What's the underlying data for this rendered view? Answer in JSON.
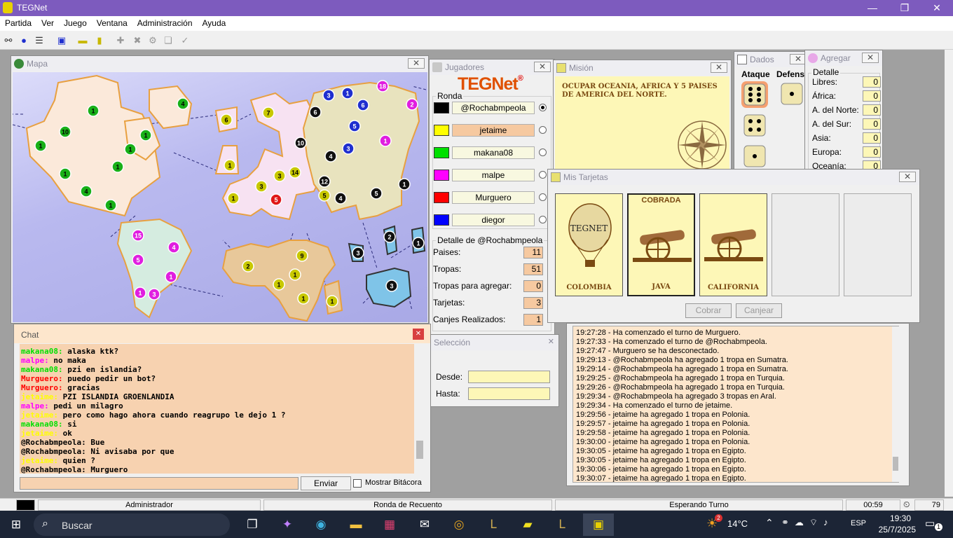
{
  "window": {
    "title": "TEGNet"
  },
  "menu": [
    "Partida",
    "Ver",
    "Juego",
    "Ventana",
    "Administración",
    "Ayuda"
  ],
  "map": {
    "title": "Mapa",
    "territories": [
      {
        "n": "1",
        "c": "#18b018"
      },
      {
        "n": "10",
        "c": "#18b018"
      },
      {
        "n": "1",
        "c": "#18b018"
      },
      {
        "n": "1",
        "c": "#18b018"
      },
      {
        "n": "1",
        "c": "#18b018"
      },
      {
        "n": "1",
        "c": "#18b018"
      },
      {
        "n": "1",
        "c": "#18b018"
      },
      {
        "n": "4",
        "c": "#18b018"
      },
      {
        "n": "1",
        "c": "#18b018"
      },
      {
        "n": "4",
        "c": "#18b018"
      },
      {
        "n": "6",
        "c": "#c8c800"
      },
      {
        "n": "1",
        "c": "#c8c800"
      },
      {
        "n": "7",
        "c": "#c8c800"
      },
      {
        "n": "3",
        "c": "#c8c800"
      },
      {
        "n": "3",
        "c": "#c8c800"
      },
      {
        "n": "1",
        "c": "#c8c800"
      },
      {
        "n": "14",
        "c": "#c8c800"
      },
      {
        "n": "5",
        "c": "#c8c800"
      },
      {
        "n": "9",
        "c": "#c8c800"
      },
      {
        "n": "2",
        "c": "#c8c800"
      },
      {
        "n": "1",
        "c": "#c8c800"
      },
      {
        "n": "1",
        "c": "#c8c800"
      },
      {
        "n": "1",
        "c": "#c8c800"
      },
      {
        "n": "1",
        "c": "#c8c800"
      },
      {
        "n": "10",
        "c": "#111111"
      },
      {
        "n": "6",
        "c": "#111111"
      },
      {
        "n": "4",
        "c": "#111111"
      },
      {
        "n": "12",
        "c": "#111111"
      },
      {
        "n": "4",
        "c": "#111111"
      },
      {
        "n": "5",
        "c": "#111111"
      },
      {
        "n": "1",
        "c": "#111111"
      },
      {
        "n": "2",
        "c": "#111111"
      },
      {
        "n": "1",
        "c": "#111111"
      },
      {
        "n": "3",
        "c": "#111111"
      },
      {
        "n": "3",
        "c": "#111111"
      },
      {
        "n": "3",
        "c": "#1f2fcf"
      },
      {
        "n": "1",
        "c": "#1f2fcf"
      },
      {
        "n": "6",
        "c": "#1f2fcf"
      },
      {
        "n": "5",
        "c": "#1f2fcf"
      },
      {
        "n": "3",
        "c": "#1f2fcf"
      },
      {
        "n": "18",
        "c": "#e01ee0"
      },
      {
        "n": "2",
        "c": "#e01ee0"
      },
      {
        "n": "1",
        "c": "#e01ee0"
      },
      {
        "n": "15",
        "c": "#e01ee0"
      },
      {
        "n": "4",
        "c": "#e01ee0"
      },
      {
        "n": "5",
        "c": "#e01ee0"
      },
      {
        "n": "1",
        "c": "#e01ee0"
      },
      {
        "n": "1",
        "c": "#e01ee0"
      },
      {
        "n": "3",
        "c": "#e01ee0"
      },
      {
        "n": "5",
        "c": "#e01818"
      }
    ]
  },
  "players": {
    "title": "Jugadores",
    "logo_a": "TEG",
    "logo_b": "Net",
    "ronda_label": "Ronda",
    "list": [
      {
        "name": "@Rochabmpeola",
        "color": "#000000",
        "selected": true,
        "highlight": false
      },
      {
        "name": "jetaime",
        "color": "#ffff00",
        "selected": false,
        "highlight": true
      },
      {
        "name": "makana08",
        "color": "#00e000",
        "selected": false,
        "highlight": false
      },
      {
        "name": "malpe",
        "color": "#ff00ff",
        "selected": false,
        "highlight": false
      },
      {
        "name": "Murguero",
        "color": "#ff0000",
        "selected": false,
        "highlight": false
      },
      {
        "name": "diegor",
        "color": "#0000ff",
        "selected": false,
        "highlight": false
      }
    ],
    "detail_title": "Detalle de @Rochabmpeola",
    "stats": [
      {
        "label": "Paises:",
        "value": "11"
      },
      {
        "label": "Tropas:",
        "value": "51"
      },
      {
        "label": "Tropas para agregar:",
        "value": "0"
      },
      {
        "label": "Tarjetas:",
        "value": "3"
      },
      {
        "label": "Canjes Realizados:",
        "value": "1"
      }
    ]
  },
  "mission": {
    "title": "Misión",
    "text": "OCUPAR OCEANIA, AFRICA Y 5 PAISES DE AMERICA DEL NORTE."
  },
  "dice": {
    "title": "Dados",
    "attack_label": "Ataque",
    "defense_label": "Defens"
  },
  "agregar": {
    "title": "Agregar",
    "group": "Detalle",
    "rows": [
      {
        "label": "Libres:",
        "value": "0"
      },
      {
        "label": "África:",
        "value": "0"
      },
      {
        "label": "A. del Norte:",
        "value": "0"
      },
      {
        "label": "A. del Sur:",
        "value": "0"
      },
      {
        "label": "Asia:",
        "value": "0"
      },
      {
        "label": "Europa:",
        "value": "0"
      },
      {
        "label": "Oceanía:",
        "value": "0"
      }
    ]
  },
  "cards": {
    "title": "Mis Tarjetas",
    "items": [
      {
        "name": "COLOMBIA",
        "type": "balloon",
        "status": "",
        "text": "TEGNET"
      },
      {
        "name": "JAVA",
        "type": "cannon",
        "status": "COBRADA"
      },
      {
        "name": "CALIFORNIA",
        "type": "cannon",
        "status": ""
      }
    ],
    "cobrar": "Cobrar",
    "canjear": "Canjear"
  },
  "chat": {
    "title": "Chat",
    "messages": [
      {
        "user": "makana08:",
        "color": "#00e000",
        "text": " alaska ktk?"
      },
      {
        "user": "malpe:",
        "color": "#ff00ff",
        "text": " no maka"
      },
      {
        "user": "makana08:",
        "color": "#00e000",
        "text": " pzi en islandia?"
      },
      {
        "user": "Murguero:",
        "color": "#ff0000",
        "text": " puedo pedir un bot?"
      },
      {
        "user": "Murguero:",
        "color": "#ff0000",
        "text": " gracias"
      },
      {
        "user": "jetaime:",
        "color": "#ffff00",
        "text": " PZI ISLANDIA GROENLANDIA"
      },
      {
        "user": "malpe:",
        "color": "#ff00ff",
        "text": " pedi un milagro"
      },
      {
        "user": "jetaime:",
        "color": "#ffff00",
        "text": " pero como hago ahora cuando reagrupo le dejo 1 ?"
      },
      {
        "user": "makana08:",
        "color": "#00e000",
        "text": " si"
      },
      {
        "user": "jetaime:",
        "color": "#ffff00",
        "text": " ok"
      },
      {
        "user": "@Rochabmpeola:",
        "color": "#000000",
        "text": " Bue"
      },
      {
        "user": "@Rochabmpeola:",
        "color": "#000000",
        "text": " Ni avisaba por que"
      },
      {
        "user": "jetaime:",
        "color": "#ffff00",
        "text": " quien  ?"
      },
      {
        "user": "@Rochabmpeola:",
        "color": "#000000",
        "text": " Murguero"
      }
    ],
    "input_value": "",
    "send_label": "Enviar",
    "show_log_label": "Mostrar Bitácora"
  },
  "selection": {
    "title": "Selección",
    "from_label": "Desde:",
    "to_label": "Hasta:"
  },
  "log": [
    "19:27:28 - Ha comenzado el turno de Murguero.",
    "19:27:33 - Ha comenzado el turno de @Rochabmpeola.",
    "19:27:47 - Murguero se ha desconectado.",
    "19:29:13 - @Rochabmpeola ha agregado 1 tropa en Sumatra.",
    "19:29:14 - @Rochabmpeola ha agregado 1 tropa en Sumatra.",
    "19:29:25 - @Rochabmpeola ha agregado 1 tropa en Turquia.",
    "19:29:26 - @Rochabmpeola ha agregado 1 tropa en Turquia.",
    "19:29:34 - @Rochabmpeola ha agregado 3 tropas en Aral.",
    "19:29:34 - Ha comenzado el turno de jetaime.",
    "19:29:56 - jetaime ha agregado 1 tropa en Polonia.",
    "19:29:57 - jetaime ha agregado 1 tropa en Polonia.",
    "19:29:58 - jetaime ha agregado 1 tropa en Polonia.",
    "19:30:00 - jetaime ha agregado 1 tropa en Polonia.",
    "19:30:05 - jetaime ha agregado 1 tropa en Egipto.",
    "19:30:05 - jetaime ha agregado 1 tropa en Egipto.",
    "19:30:06 - jetaime ha agregado 1 tropa en Egipto.",
    "19:30:07 - jetaime ha agregado 1 tropa en Egipto."
  ],
  "status": {
    "role": "Administrador",
    "phase": "Ronda de Recuento",
    "state": "Esperando Turno",
    "timer": "00:59",
    "count": "79"
  },
  "taskbar": {
    "search": "Buscar",
    "weather": "14°C",
    "weather_badge": "2",
    "lang": "ESP",
    "time": "19:30",
    "date": "25/7/2025",
    "notif": "1"
  }
}
